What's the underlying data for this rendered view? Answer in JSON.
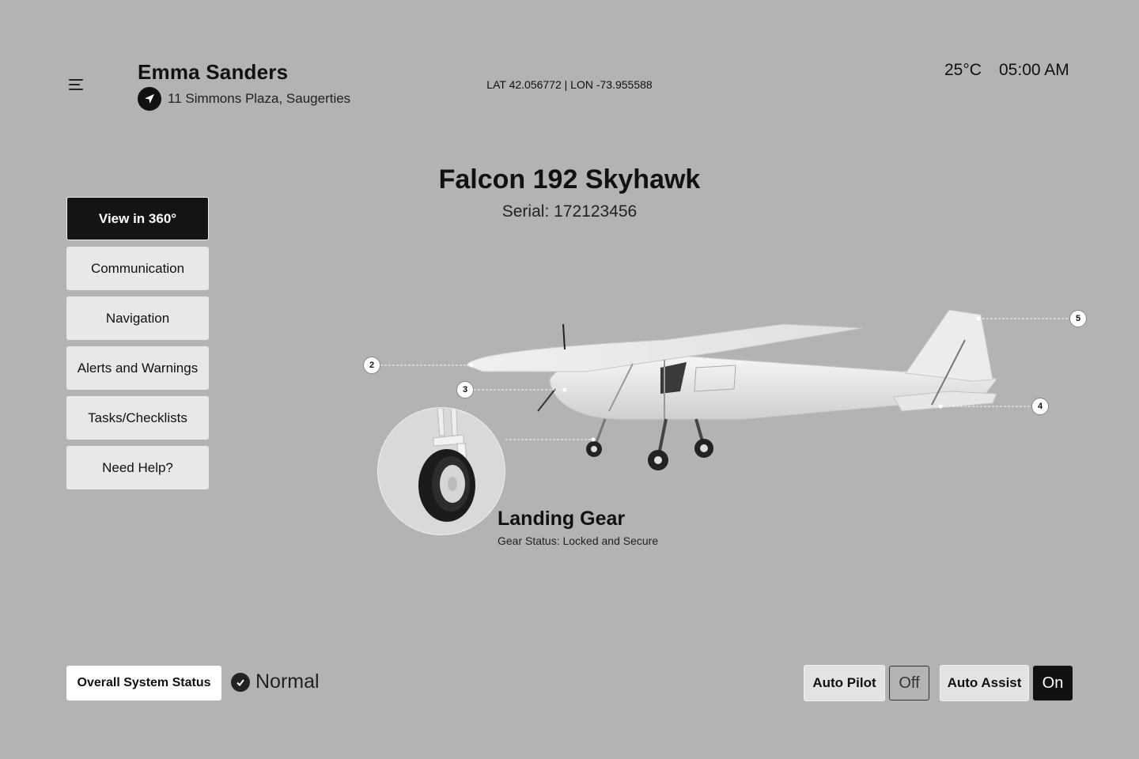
{
  "header": {
    "user_name": "Emma Sanders",
    "location": "11 Simmons Plaza, Saugerties",
    "coordinates": "LAT 42.056772 | LON -73.955588",
    "temperature": "25°C",
    "time": "05:00 AM"
  },
  "sidebar": {
    "items": [
      {
        "label": "View in 360°",
        "active": true
      },
      {
        "label": "Communication",
        "active": false
      },
      {
        "label": "Navigation",
        "active": false
      },
      {
        "label": "Alerts and Warnings",
        "active": false
      },
      {
        "label": "Tasks/Checklists",
        "active": false
      },
      {
        "label": "Need Help?",
        "active": false
      }
    ]
  },
  "aircraft": {
    "name": "Falcon 192 Skyhawk",
    "serial": "Serial: 172123456"
  },
  "callouts": {
    "pins": [
      "2",
      "3",
      "4",
      "5"
    ],
    "selected_part": {
      "title": "Landing Gear",
      "status": "Gear Status: Locked and Secure"
    }
  },
  "footer": {
    "system_status_label": "Overall System Status",
    "system_status_value": "Normal",
    "autopilot": {
      "label": "Auto Pilot",
      "state": "Off"
    },
    "auto_assist": {
      "label": "Auto Assist",
      "state": "On"
    }
  },
  "colors": {
    "background": "#b3b3b3",
    "active_button": "#141414",
    "button": "#e8e8e8"
  }
}
